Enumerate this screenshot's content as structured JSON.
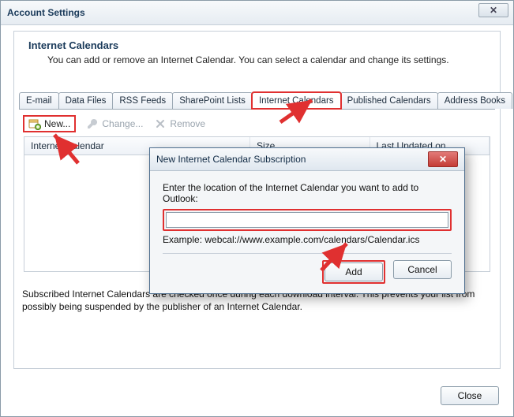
{
  "window": {
    "title": "Account Settings"
  },
  "section": {
    "heading": "Internet Calendars",
    "description": "You can add or remove an Internet Calendar. You can select a calendar and change its settings."
  },
  "tabs": {
    "items": [
      {
        "label": "E-mail"
      },
      {
        "label": "Data Files"
      },
      {
        "label": "RSS Feeds"
      },
      {
        "label": "SharePoint Lists"
      },
      {
        "label": "Internet Calendars"
      },
      {
        "label": "Published Calendars"
      },
      {
        "label": "Address Books"
      }
    ],
    "active_index": 4
  },
  "toolbar": {
    "new_label": "New...",
    "change_label": "Change...",
    "remove_label": "Remove"
  },
  "columns": {
    "name": "Internet Calendar",
    "size": "Size",
    "updated": "Last Updated on"
  },
  "note_text": "Subscribed Internet Calendars are checked once during each download interval. This prevents your list from possibly being suspended by the publisher of an Internet Calendar.",
  "close_label": "Close",
  "dialog": {
    "title": "New Internet Calendar Subscription",
    "prompt": "Enter the location of the Internet Calendar you want to add to Outlook:",
    "input_value": "",
    "example": "Example: webcal://www.example.com/calendars/Calendar.ics",
    "add_label": "Add",
    "cancel_label": "Cancel"
  },
  "colors": {
    "highlight": "#e03030"
  }
}
